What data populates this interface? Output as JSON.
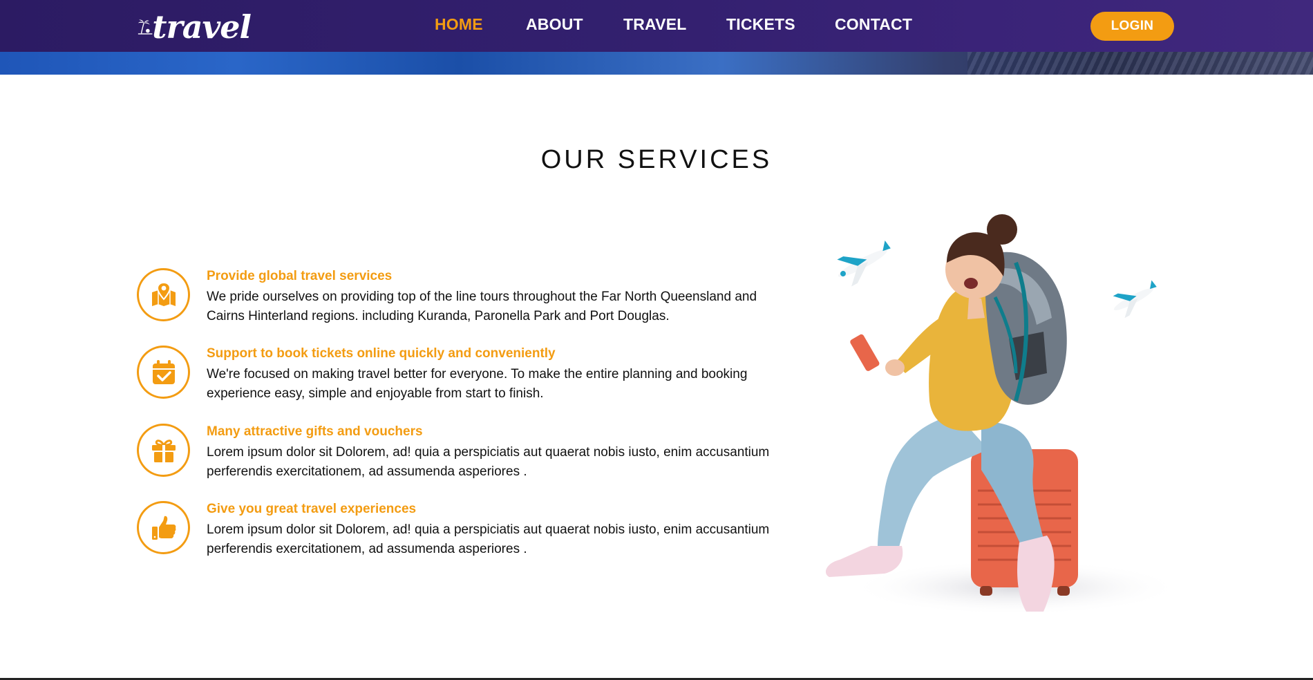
{
  "header": {
    "logo_text": "travel",
    "nav": [
      {
        "label": "HOME",
        "active": true
      },
      {
        "label": "ABOUT",
        "active": false
      },
      {
        "label": "TRAVEL",
        "active": false
      },
      {
        "label": "TICKETS",
        "active": false
      },
      {
        "label": "CONTACT",
        "active": false
      }
    ],
    "login_label": "LOGIN"
  },
  "colors": {
    "accent": "#f39c12",
    "header_bg": "#2c1b63",
    "text": "#111111"
  },
  "services": {
    "title": "OUR SERVICES",
    "items": [
      {
        "icon": "map-pin-icon",
        "title": "Provide global travel services",
        "text": "We pride ourselves on providing top of the line tours throughout the Far North Queensland and Cairns Hinterland regions. including Kuranda, Paronella Park and Port Douglas."
      },
      {
        "icon": "calendar-check-icon",
        "title": "Support to book tickets online quickly and conveniently",
        "text": "We're focused on making travel better for everyone. To make the entire planning and booking experience easy, simple and enjoyable from start to finish."
      },
      {
        "icon": "gift-icon",
        "title": "Many attractive gifts and vouchers",
        "text": "Lorem ipsum dolor sit Dolorem, ad! quia a perspiciatis aut quaerat nobis iusto, enim accusantium perferendis exercitationem, ad assumenda asperiores ."
      },
      {
        "icon": "thumbs-up-icon",
        "title": "Give you great travel experiences",
        "text": "Lorem ipsum dolor sit Dolorem, ad! quia a perspiciatis aut quaerat nobis iusto, enim accusantium perferendis exercitationem, ad assumenda asperiores ."
      }
    ]
  }
}
